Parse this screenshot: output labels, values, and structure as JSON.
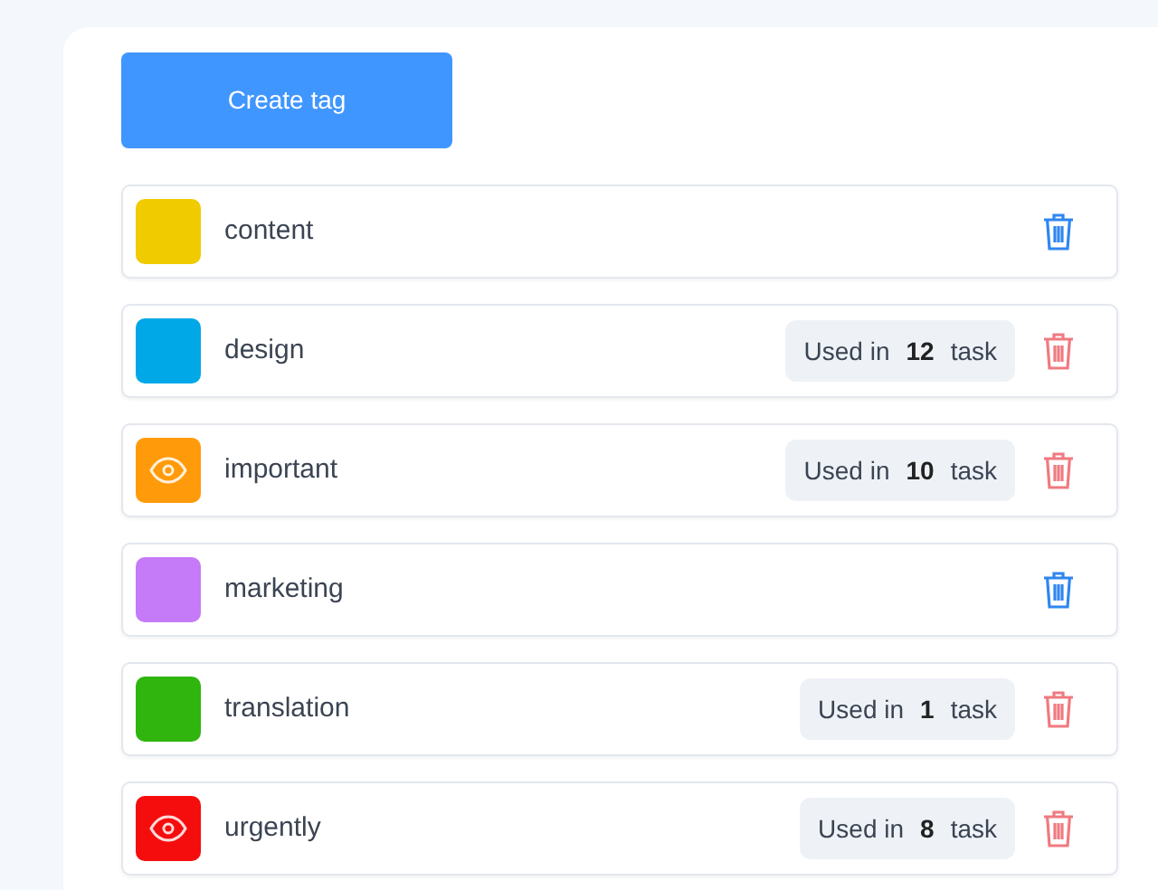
{
  "create_button": "Create tag",
  "tags": [
    {
      "name": "content",
      "color": "#f0cb00",
      "eye": false
    },
    {
      "name": "design",
      "color": "#00a8e8",
      "eye": false,
      "usage": {
        "prefix": "Used in",
        "count": "12",
        "suffix": "task"
      }
    },
    {
      "name": "important",
      "color": "#ff9a0a",
      "eye": true,
      "usage": {
        "prefix": "Used in",
        "count": "10",
        "suffix": "task"
      }
    },
    {
      "name": "marketing",
      "color": "#c57af7",
      "eye": false
    },
    {
      "name": "translation",
      "color": "#2fb50e",
      "eye": false,
      "usage": {
        "prefix": "Used in",
        "count": "1",
        "suffix": "task"
      }
    },
    {
      "name": "urgently",
      "color": "#f50d0d",
      "eye": true,
      "usage": {
        "prefix": "Used in",
        "count": "8",
        "suffix": "task"
      }
    }
  ]
}
